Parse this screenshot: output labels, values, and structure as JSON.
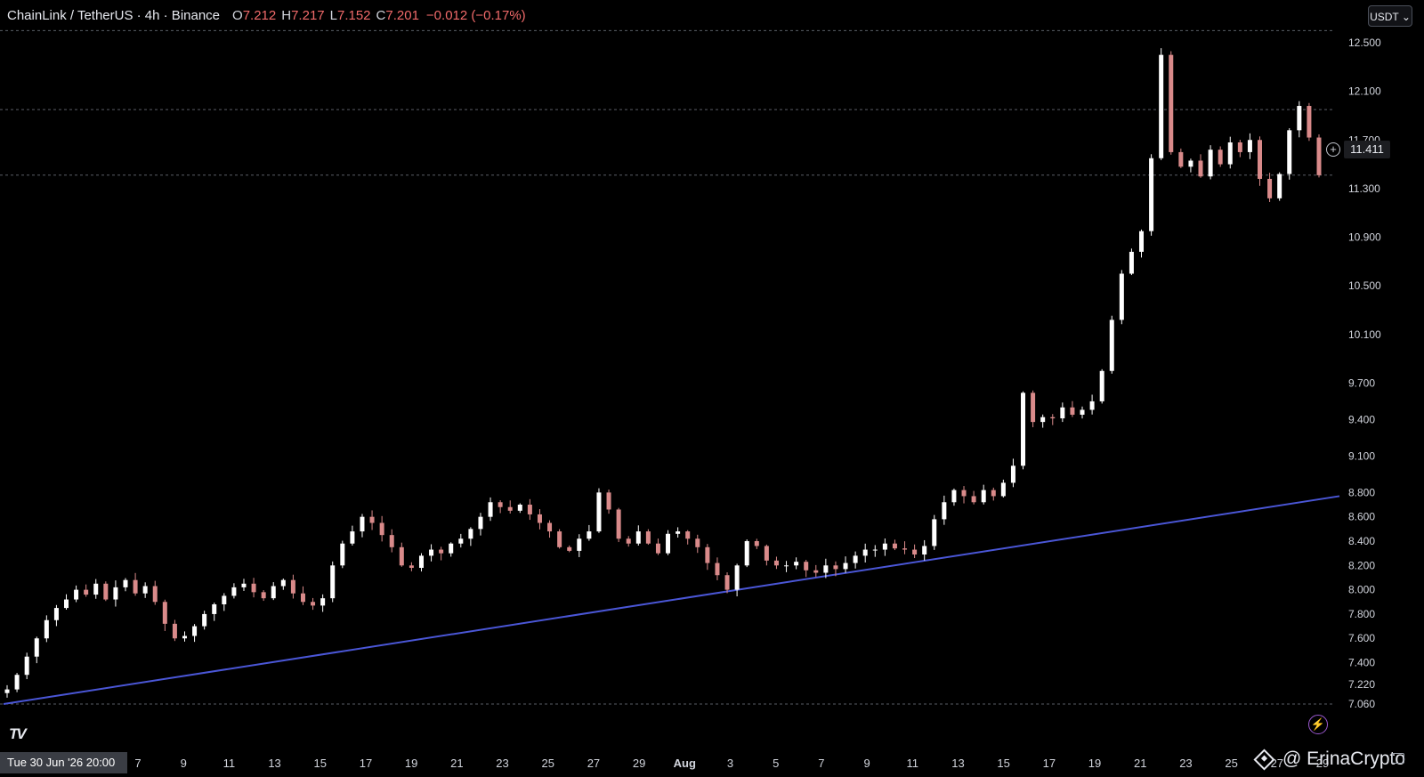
{
  "header": {
    "title": "ChainLink / TetherUS · 4h · Binance",
    "o_label": "O",
    "o_value": "7.212",
    "h_label": "H",
    "h_value": "7.217",
    "l_label": "L",
    "l_value": "7.152",
    "c_label": "C",
    "c_value": "7.201",
    "change": "−0.012 (−0.17%)"
  },
  "currency_button": {
    "label": "USDT",
    "icon": "chevron-down-icon"
  },
  "price_label": {
    "value": "11.411",
    "icon": "plus-circle-icon"
  },
  "time_axis": {
    "highlight_label": "Tue 30 Jun '26  20:00"
  },
  "watermark": {
    "icon": "binance-logo-icon",
    "text": "@ ErinaCrypto"
  },
  "logo": {
    "text": "TV",
    "icon": "tradingview-logo-icon"
  },
  "colors": {
    "background": "#000000",
    "candle_up": "#ffffff",
    "candle_down": "#d98a8a",
    "trendline": "#4a56d6",
    "grid_dashed": "#5a5e66",
    "axis_text": "#d1d4dc",
    "change_text": "#f06a6a"
  },
  "chart_data": {
    "type": "candlestick",
    "ylim": [
      7.03,
      12.63
    ],
    "y_ticks": [
      "12.500",
      "12.100",
      "11.700",
      "11.300",
      "10.900",
      "10.500",
      "10.100",
      "9.700",
      "9.400",
      "9.100",
      "8.800",
      "8.600",
      "8.400",
      "8.200",
      "8.000",
      "7.800",
      "7.600",
      "7.400",
      "7.220",
      "7.060"
    ],
    "x_ticks": [
      "7",
      "9",
      "11",
      "13",
      "15",
      "17",
      "19",
      "21",
      "23",
      "25",
      "27",
      "29",
      "Aug",
      "3",
      "5",
      "7",
      "9",
      "11",
      "13",
      "15",
      "17",
      "19",
      "21",
      "23",
      "25",
      "27",
      "29"
    ],
    "horizontal_levels": [
      12.6,
      11.95,
      11.411,
      7.06
    ],
    "trendline": {
      "start": {
        "x": "Jun 30 '26 20:00",
        "y": 7.06
      },
      "end": {
        "x": "Aug 29",
        "y": 8.77
      }
    },
    "close_series": [
      7.18,
      7.3,
      7.45,
      7.6,
      7.75,
      7.85,
      7.92,
      8.0,
      7.96,
      8.05,
      7.92,
      8.02,
      8.08,
      7.97,
      8.03,
      7.9,
      7.72,
      7.6,
      7.62,
      7.7,
      7.8,
      7.88,
      7.95,
      8.02,
      8.05,
      7.98,
      7.93,
      8.03,
      8.08,
      7.97,
      7.9,
      7.87,
      7.93,
      8.2,
      8.38,
      8.48,
      8.6,
      8.55,
      8.45,
      8.35,
      8.2,
      8.18,
      8.28,
      8.33,
      8.3,
      8.38,
      8.42,
      8.5,
      8.6,
      8.72,
      8.68,
      8.65,
      8.7,
      8.62,
      8.55,
      8.48,
      8.35,
      8.32,
      8.42,
      8.48,
      8.8,
      8.66,
      8.42,
      8.38,
      8.48,
      8.38,
      8.3,
      8.46,
      8.48,
      8.42,
      8.35,
      8.22,
      8.12,
      8.0,
      8.2,
      8.4,
      8.36,
      8.24,
      8.2,
      8.2,
      8.23,
      8.16,
      8.14,
      8.2,
      8.17,
      8.22,
      8.28,
      8.33,
      8.33,
      8.38,
      8.34,
      8.33,
      8.29,
      8.36,
      8.58,
      8.72,
      8.82,
      8.77,
      8.72,
      8.82,
      8.77,
      8.88,
      9.02,
      9.62,
      9.38,
      9.42,
      9.41,
      9.5,
      9.44,
      9.48,
      9.55,
      9.8,
      10.22,
      10.6,
      10.78,
      10.95,
      11.55,
      12.4,
      11.6,
      11.48,
      11.53,
      11.4,
      11.62,
      11.5,
      11.68,
      11.6,
      11.7,
      11.38,
      11.22,
      11.42,
      11.78,
      11.98,
      11.72,
      11.41
    ]
  }
}
